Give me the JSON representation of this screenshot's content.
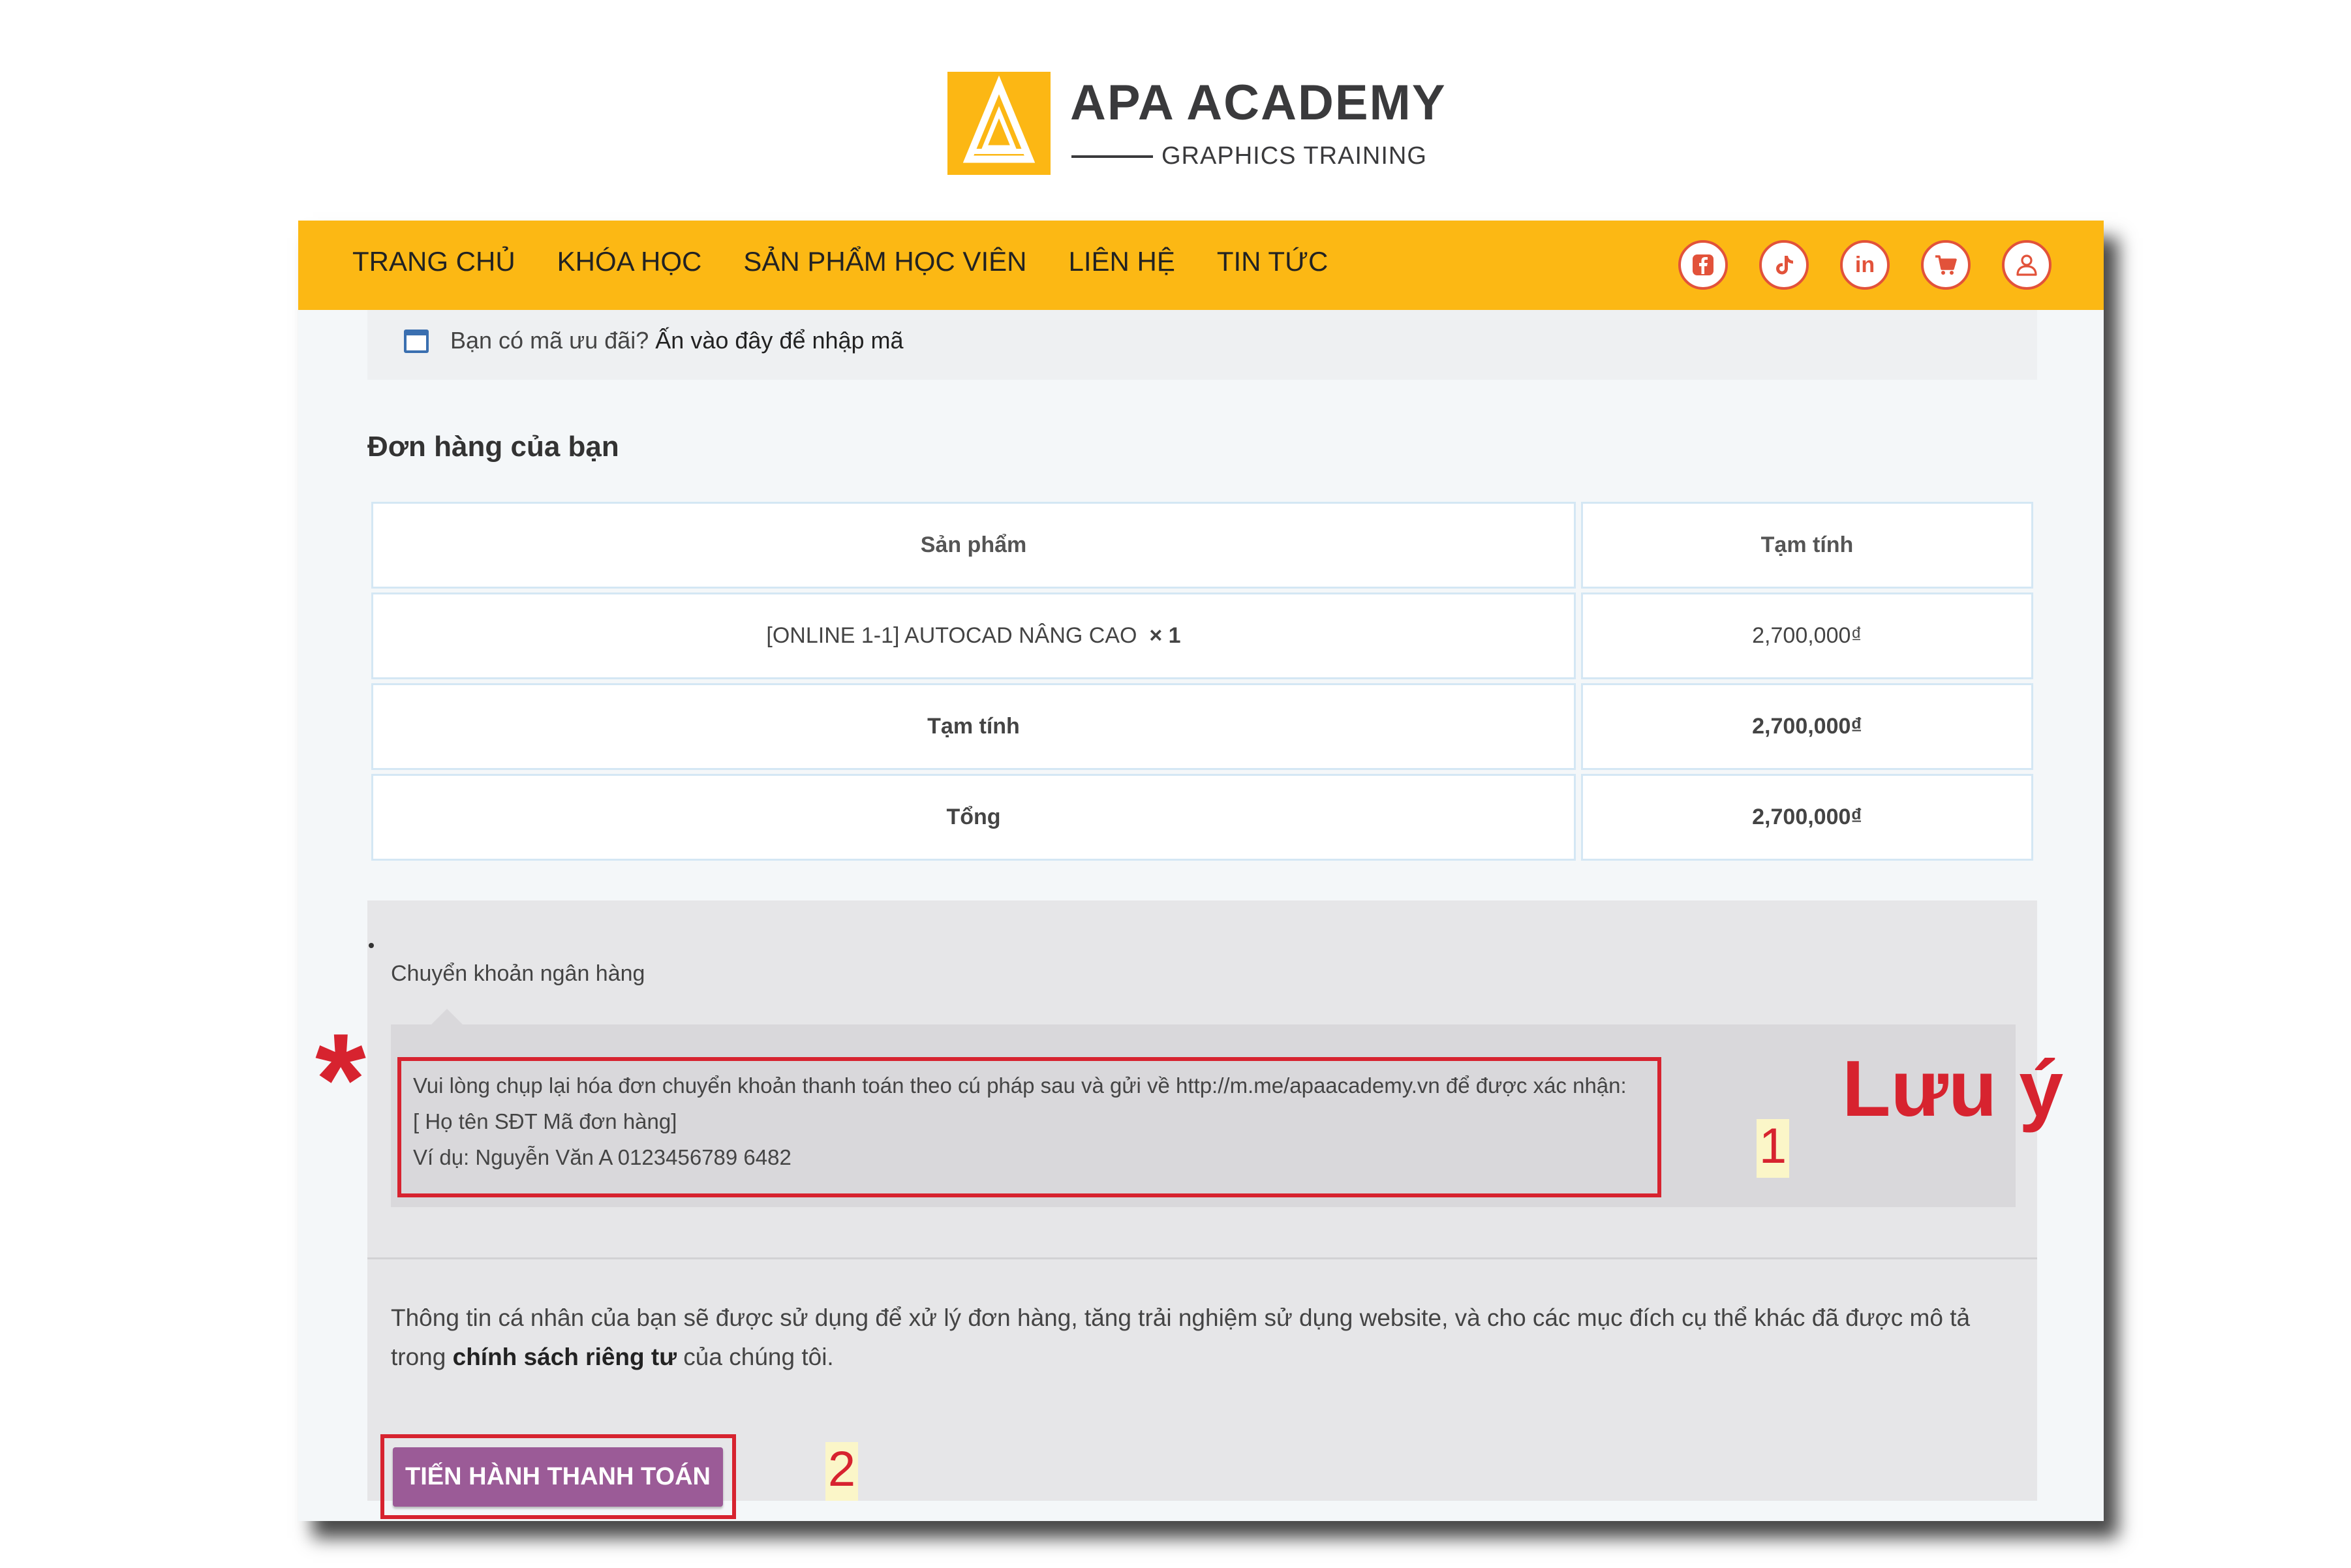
{
  "brand": {
    "name": "APA ACADEMY",
    "tagline": "GRAPHICS TRAINING",
    "accent_color": "#fcb714",
    "logo_icon": "triangle-logo-icon"
  },
  "nav": {
    "menu": [
      {
        "label": "TRANG CHỦ"
      },
      {
        "label": "KHÓA HỌC"
      },
      {
        "label": "SẢN PHẨM HỌC VIÊN"
      },
      {
        "label": "LIÊN HỆ"
      },
      {
        "label": "TIN TỨC"
      }
    ],
    "icons": [
      "facebook-icon",
      "tiktok-icon",
      "linkedin-icon",
      "cart-icon",
      "user-icon"
    ],
    "linkedin_text": "in"
  },
  "coupon": {
    "prompt": "Bạn có mã ưu đãi?",
    "link": "Ấn vào đây để nhập mã"
  },
  "order": {
    "title": "Đơn hàng của bạn",
    "headers": [
      "Sản phẩm",
      "Tạm tính"
    ],
    "item": {
      "name": "[ONLINE 1-1] AUTOCAD NÂNG CAO",
      "qty": "× 1",
      "price": "2,700,000₫"
    },
    "subtotal": {
      "label": "Tạm tính",
      "value": "2,700,000₫"
    },
    "total": {
      "label": "Tổng",
      "value": "2,700,000₫"
    }
  },
  "payment": {
    "method_label": "Chuyển khoản ngân hàng",
    "note_lines": [
      "Vui lòng chụp lại hóa đơn chuyển khoản thanh toán theo cú pháp sau và gửi về http://m.me/apaacademy.vn để được xác nhận:",
      "[ Họ tên SĐT Mã đơn hàng]",
      "Ví dụ: Nguyễn Văn A 0123456789 6482"
    ],
    "privacy_text": "Thông tin cá nhân của bạn sẽ được sử dụng để xử lý đơn hàng, tăng trải nghiệm sử dụng website, và cho các mục đích cụ thể khác đã được mô tả trong ",
    "privacy_link": "chính sách riêng tư",
    "privacy_suffix": " của chúng tôi.",
    "button_label": "TIẾN HÀNH THANH TOÁN"
  },
  "annotations": {
    "asterisk": "*",
    "note_title": "Lưu ý",
    "badge_1": "1",
    "badge_2": "2",
    "highlight_color": "#d7232f"
  }
}
